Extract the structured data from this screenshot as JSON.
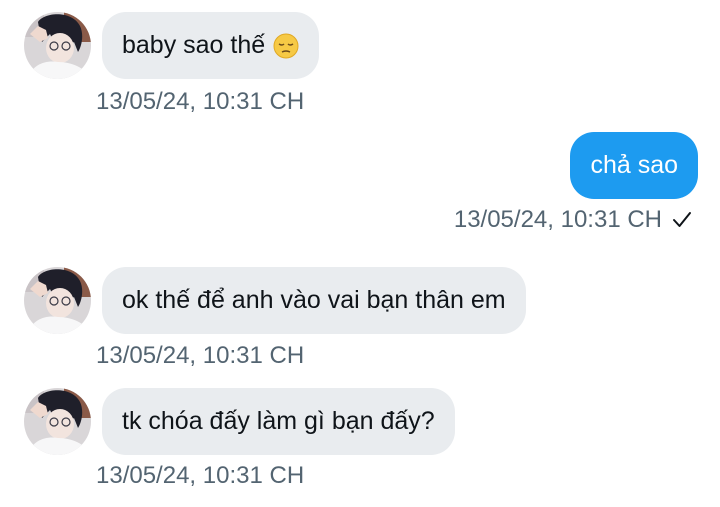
{
  "messages": [
    {
      "direction": "incoming",
      "text": "baby sao thế",
      "emoji": "pensive-face-emoji",
      "timestamp": "13/05/24, 10:31 CH"
    },
    {
      "direction": "outgoing",
      "text": "chả sao",
      "timestamp": "13/05/24, 10:31 CH",
      "status_icon": "check-icon"
    },
    {
      "direction": "incoming",
      "text": "ok thế để anh vào vai bạn thân em",
      "timestamp": "13/05/24, 10:31 CH"
    },
    {
      "direction": "incoming",
      "text": "tk chóa đấy làm gì bạn đấy?",
      "timestamp": "13/05/24, 10:31 CH"
    }
  ],
  "colors": {
    "incoming_bubble": "#e9ecef",
    "outgoing_bubble": "#1d9bf0",
    "timestamp_text": "#536471"
  }
}
